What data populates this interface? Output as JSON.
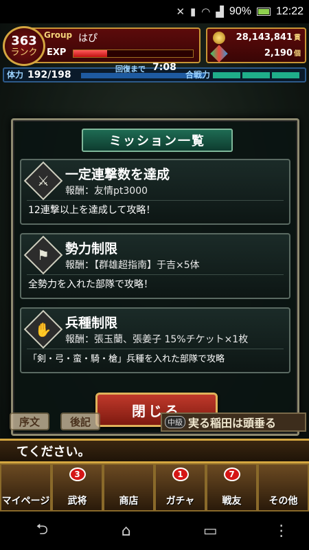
{
  "status_bar": {
    "battery_percent": "90%",
    "time": "12:22"
  },
  "header": {
    "rank_number": "363",
    "rank_label": "ランク",
    "group_tag": "Group",
    "player_name": "はぴ",
    "exp_label": "EXP",
    "exp_fraction": 0.28,
    "gold": "28,143,841",
    "gold_unit": "貫",
    "gems": "2,190",
    "gems_unit": "個",
    "stamina_label": "体力",
    "stamina_value": "192/198",
    "recover_label": "回復まで",
    "recover_time": "7:08",
    "power_label": "合戦力"
  },
  "modal": {
    "title": "ミッション一覧",
    "missions": [
      {
        "icon": "sword-icon",
        "title": "一定連撃数を達成",
        "reward": "報酬：友情pt3000",
        "description": "12連撃以上を達成して攻略！"
      },
      {
        "icon": "flag-icon",
        "title": "勢力制限",
        "reward": "報酬：【群雄超指南】于吉×5体",
        "description": "全勢力を入れた部隊で攻略！"
      },
      {
        "icon": "gauntlet-icon",
        "title": "兵種制限",
        "reward": "報酬：張玉蘭、張姜子 15%チケット×1枚",
        "description": "「剣・弓・蛮・騎・槍」兵種を入れた部隊で攻略"
      }
    ],
    "close_label": "閉じる"
  },
  "chapter_tabs": [
    "序文",
    "後記"
  ],
  "quest": {
    "level": "中級",
    "name": "実る稲田は頭垂る"
  },
  "message": "てください。",
  "bottom_nav": [
    {
      "label": "マイページ",
      "badge": ""
    },
    {
      "label": "武将",
      "badge": "3"
    },
    {
      "label": "商店",
      "badge": ""
    },
    {
      "label": "ガチャ",
      "badge": "1"
    },
    {
      "label": "戦友",
      "badge": "7"
    },
    {
      "label": "その他",
      "badge": ""
    }
  ]
}
